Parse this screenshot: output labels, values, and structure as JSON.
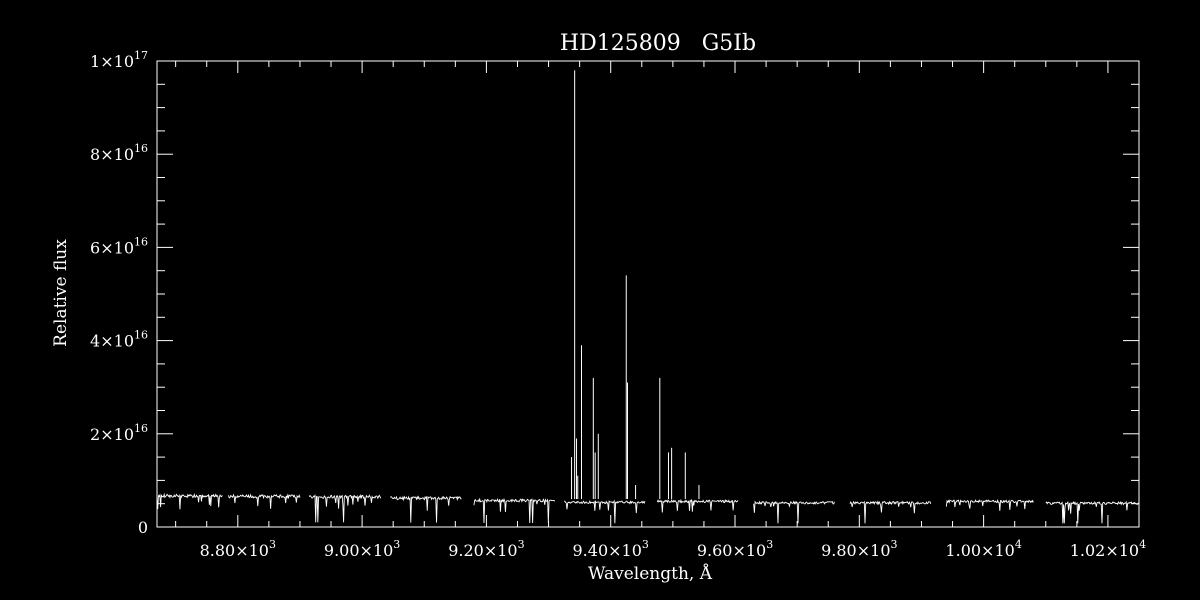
{
  "chart_data": {
    "type": "line",
    "title": "HD125809   G5Ib",
    "xlabel": "Wavelength, Å",
    "ylabel": "Relative flux",
    "xlim": [
      8670,
      10250
    ],
    "ylim": [
      0,
      1e+17
    ],
    "x_ticks": [
      {
        "value": 8800,
        "mant": "8.80",
        "exp": "3"
      },
      {
        "value": 9000,
        "mant": "9.00",
        "exp": "3"
      },
      {
        "value": 9200,
        "mant": "9.20",
        "exp": "3"
      },
      {
        "value": 9400,
        "mant": "9.40",
        "exp": "3"
      },
      {
        "value": 9600,
        "mant": "9.60",
        "exp": "3"
      },
      {
        "value": 9800,
        "mant": "9.80",
        "exp": "3"
      },
      {
        "value": 10000,
        "mant": "1.00",
        "exp": "4"
      },
      {
        "value": 10200,
        "mant": "1.02",
        "exp": "4"
      }
    ],
    "y_ticks": [
      {
        "value": 0,
        "mant": "0",
        "exp": ""
      },
      {
        "value": 2e+16,
        "mant": "2",
        "exp": "16"
      },
      {
        "value": 4e+16,
        "mant": "4",
        "exp": "16"
      },
      {
        "value": 6e+16,
        "mant": "6",
        "exp": "16"
      },
      {
        "value": 8e+16,
        "mant": "8",
        "exp": "16"
      },
      {
        "value": 1e+17,
        "mant": "1",
        "exp": "17"
      }
    ],
    "grid": false,
    "legend": "none",
    "color": "#ffffff",
    "segments": [
      {
        "x0": 8670,
        "x1": 8775,
        "level": 6800000000000000.0
      },
      {
        "x0": 8785,
        "x1": 8900,
        "level": 6700000000000000.0
      },
      {
        "x0": 8915,
        "x1": 9030,
        "level": 6600000000000000.0
      },
      {
        "x0": 9045,
        "x1": 9160,
        "level": 6300000000000000.0
      },
      {
        "x0": 9180,
        "x1": 9310,
        "level": 5800000000000000.0
      },
      {
        "x0": 9325,
        "x1": 9455,
        "level": 5400000000000000.0
      },
      {
        "x0": 9475,
        "x1": 9605,
        "level": 5600000000000000.0
      },
      {
        "x0": 9630,
        "x1": 9760,
        "level": 5300000000000000.0
      },
      {
        "x0": 9785,
        "x1": 9915,
        "level": 5300000000000000.0
      },
      {
        "x0": 9940,
        "x1": 10080,
        "level": 5600000000000000.0
      },
      {
        "x0": 10100,
        "x1": 10250,
        "level": 5200000000000000.0
      }
    ],
    "spikes": [
      {
        "x": 9337,
        "y": 1.5e+16
      },
      {
        "x": 9342,
        "y": 9.8e+16
      },
      {
        "x": 9345,
        "y": 1.9e+16
      },
      {
        "x": 9347,
        "y": 1.1e+16
      },
      {
        "x": 9353,
        "y": 3.9e+16
      },
      {
        "x": 9372,
        "y": 3.2e+16
      },
      {
        "x": 9375,
        "y": 1.6e+16
      },
      {
        "x": 9380,
        "y": 2e+16
      },
      {
        "x": 9425,
        "y": 5.4e+16
      },
      {
        "x": 9427,
        "y": 3.1e+16
      },
      {
        "x": 9440,
        "y": 9000000000000000.0
      },
      {
        "x": 9479,
        "y": 3.2e+16
      },
      {
        "x": 9493,
        "y": 1.6e+16
      },
      {
        "x": 9498,
        "y": 1.7e+16
      },
      {
        "x": 9520,
        "y": 1.6e+16
      },
      {
        "x": 9542,
        "y": 9000000000000000.0
      }
    ]
  }
}
